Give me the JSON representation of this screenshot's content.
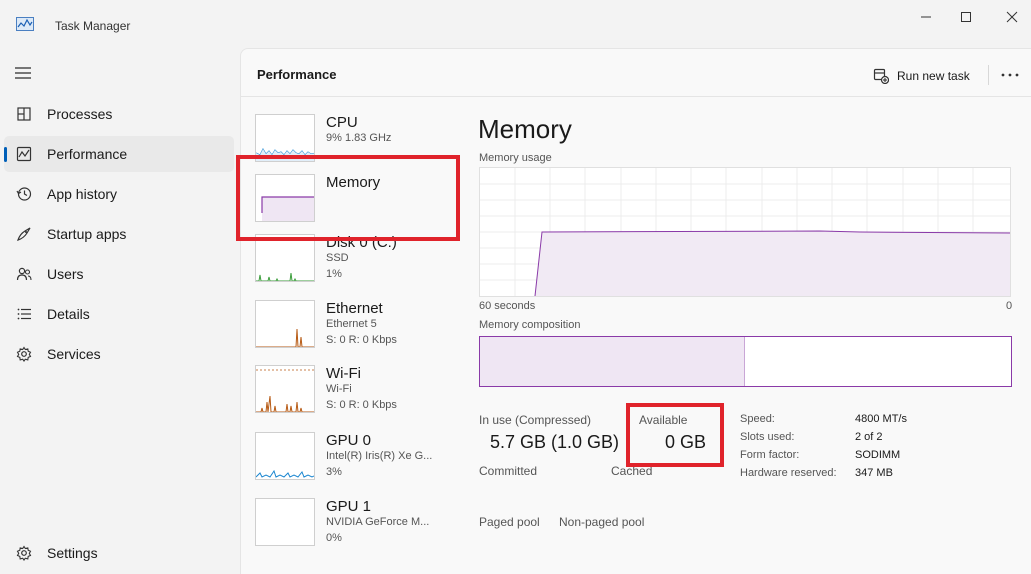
{
  "app": {
    "title": "Task Manager"
  },
  "colors": {
    "accent": "#005fb8",
    "memory": "#8a3aa8",
    "cpu": "#1a86d0",
    "disk": "#3b9d3b",
    "network": "#b75a14",
    "highlight": "#e0232b"
  },
  "nav": {
    "items": [
      {
        "label": "Processes",
        "icon": "processes-icon"
      },
      {
        "label": "Performance",
        "icon": "performance-icon",
        "active": true
      },
      {
        "label": "App history",
        "icon": "app-history-icon"
      },
      {
        "label": "Startup apps",
        "icon": "startup-apps-icon"
      },
      {
        "label": "Users",
        "icon": "users-icon"
      },
      {
        "label": "Details",
        "icon": "details-icon"
      },
      {
        "label": "Services",
        "icon": "services-icon"
      }
    ],
    "settings_label": "Settings"
  },
  "header": {
    "title": "Performance",
    "run_new_task": "Run new task"
  },
  "resources": [
    {
      "name": "CPU",
      "lines": [
        "9% 1.83 GHz"
      ]
    },
    {
      "name": "Memory",
      "lines": []
    },
    {
      "name": "Disk 0 (C:)",
      "lines": [
        "SSD",
        "1%"
      ]
    },
    {
      "name": "Ethernet",
      "lines": [
        "Ethernet 5",
        "S: 0 R: 0 Kbps"
      ]
    },
    {
      "name": "Wi-Fi",
      "lines": [
        "Wi-Fi",
        "S: 0 R: 0 Kbps"
      ]
    },
    {
      "name": "GPU 0",
      "lines": [
        "Intel(R) Iris(R) Xe G...",
        "3%"
      ]
    },
    {
      "name": "GPU 1",
      "lines": [
        "NVIDIA GeForce M...",
        "0%"
      ]
    }
  ],
  "memory": {
    "title": "Memory",
    "usage_label": "Memory usage",
    "axis_left": "60 seconds",
    "axis_right": "0",
    "composition_label": "Memory composition",
    "in_use_label": "In use (Compressed)",
    "in_use_value": "5.7 GB (1.0 GB)",
    "available_label": "Available",
    "available_value": "0 GB",
    "committed_label": "Committed",
    "cached_label": "Cached",
    "paged_pool_label": "Paged pool",
    "non_paged_pool_label": "Non-paged pool",
    "specs": [
      {
        "label": "Speed:",
        "value": "4800 MT/s"
      },
      {
        "label": "Slots used:",
        "value": "2 of 2"
      },
      {
        "label": "Form factor:",
        "value": "SODIMM"
      },
      {
        "label": "Hardware reserved:",
        "value": "347 MB"
      }
    ]
  }
}
